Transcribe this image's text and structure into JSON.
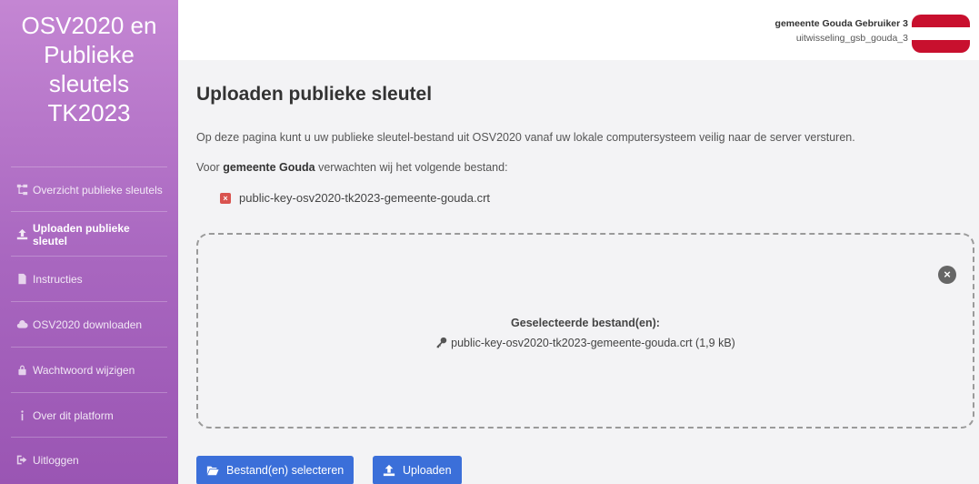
{
  "sidebar": {
    "brand": "OSV2020 en Publieke sleutels TK2023",
    "items": [
      {
        "label": "Overzicht publieke sleutels",
        "icon": "sitemap-icon"
      },
      {
        "label": "Uploaden publieke sleutel",
        "icon": "upload-icon"
      },
      {
        "label": "Instructies",
        "icon": "file-icon"
      },
      {
        "label": "OSV2020 downloaden",
        "icon": "cloud-download-icon"
      },
      {
        "label": "Wachtwoord wijzigen",
        "icon": "lock-icon"
      },
      {
        "label": "Over dit platform",
        "icon": "info-icon"
      },
      {
        "label": "Uitloggen",
        "icon": "sign-out-icon"
      }
    ]
  },
  "header": {
    "user_name": "gemeente Gouda Gebruiker 3",
    "user_account": "uitwisseling_gsb_gouda_3",
    "flag_colors": [
      "#c8102e",
      "#ffffff",
      "#c8102e"
    ]
  },
  "main": {
    "title": "Uploaden publieke sleutel",
    "intro": "Op deze pagina kunt u uw publieke sleutel-bestand uit OSV2020 vanaf uw lokale computersysteem veilig naar de server versturen.",
    "expect_prefix": "Voor ",
    "expect_bold": "gemeente Gouda",
    "expect_suffix": " verwachten wij het volgende bestand:",
    "expected_file": "public-key-osv2020-tk2023-gemeente-gouda.crt",
    "dropzone": {
      "selected_title": "Geselecteerde bestand(en):",
      "selected_file": "public-key-osv2020-tk2023-gemeente-gouda.crt (1,9 kB)"
    },
    "buttons": {
      "select_label": "Bestand(en) selecteren",
      "upload_label": "Uploaden"
    }
  },
  "colors": {
    "accent": "#3b6fd9",
    "sidebar_top": "#c486d3",
    "sidebar_bottom": "#9a55b3",
    "error": "#d9534f"
  }
}
